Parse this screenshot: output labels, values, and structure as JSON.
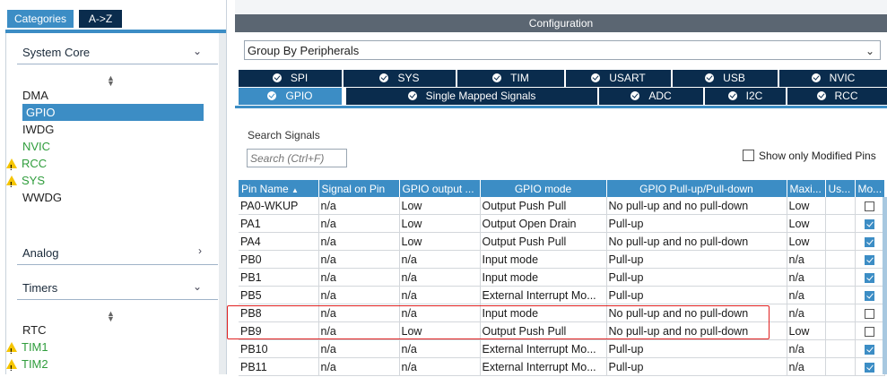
{
  "left_tabs": {
    "categories": "Categories",
    "az": "A->Z"
  },
  "sections": {
    "system_core": "System Core",
    "analog": "Analog",
    "timers": "Timers"
  },
  "system_core_items": [
    {
      "label": "DMA",
      "status": "none"
    },
    {
      "label": "GPIO",
      "status": "selected"
    },
    {
      "label": "IWDG",
      "status": "none"
    },
    {
      "label": "NVIC",
      "status": "ok"
    },
    {
      "label": "RCC",
      "status": "warning"
    },
    {
      "label": "SYS",
      "status": "warning"
    },
    {
      "label": "WWDG",
      "status": "none"
    }
  ],
  "timer_items": [
    {
      "label": "RTC",
      "status": "none"
    },
    {
      "label": "TIM1",
      "status": "warning"
    },
    {
      "label": "TIM2",
      "status": "warning"
    }
  ],
  "configuration": {
    "title": "Configuration",
    "group_by": "Group By Peripherals",
    "tabs_row1": [
      "SPI",
      "SYS",
      "TIM",
      "USART",
      "USB",
      "NVIC"
    ],
    "tabs_row2": [
      "GPIO",
      "Single Mapped Signals",
      "ADC",
      "I2C",
      "RCC"
    ],
    "active_tab": "GPIO"
  },
  "search": {
    "label": "Search Signals",
    "placeholder": "Search (Ctrl+F)"
  },
  "show_modified": "Show only Modified Pins",
  "table": {
    "headers": [
      "Pin Name",
      "Signal on Pin",
      "GPIO output ...",
      "GPIO mode",
      "GPIO Pull-up/Pull-down",
      "Maxi...",
      "Us...",
      "Mo..."
    ],
    "rows": [
      [
        "PA0-WKUP",
        "n/a",
        "Low",
        "Output Push Pull",
        "No pull-up and no pull-down",
        "Low",
        "",
        false
      ],
      [
        "PA1",
        "n/a",
        "Low",
        "Output Open Drain",
        "Pull-up",
        "Low",
        "",
        true
      ],
      [
        "PA4",
        "n/a",
        "Low",
        "Output Push Pull",
        "No pull-up and no pull-down",
        "Low",
        "",
        true
      ],
      [
        "PB0",
        "n/a",
        "n/a",
        "Input mode",
        "Pull-up",
        "n/a",
        "",
        true
      ],
      [
        "PB1",
        "n/a",
        "n/a",
        "Input mode",
        "Pull-up",
        "n/a",
        "",
        true
      ],
      [
        "PB5",
        "n/a",
        "n/a",
        "External Interrupt Mo...",
        "Pull-up",
        "n/a",
        "",
        true
      ],
      [
        "PB8",
        "n/a",
        "n/a",
        "Input mode",
        "No pull-up and no pull-down",
        "n/a",
        "",
        false
      ],
      [
        "PB9",
        "n/a",
        "Low",
        "Output Push Pull",
        "No pull-up and no pull-down",
        "Low",
        "",
        false
      ],
      [
        "PB10",
        "n/a",
        "n/a",
        "External Interrupt Mo...",
        "Pull-up",
        "n/a",
        "",
        true
      ],
      [
        "PB11",
        "n/a",
        "n/a",
        "External Interrupt Mo...",
        "Pull-up",
        "n/a",
        "",
        true
      ]
    ]
  },
  "colors": {
    "accent": "#3c8dc5",
    "dark_tab": "#0a2c4d",
    "header_bar": "#5b6672",
    "ok": "#2f9d3c",
    "warning": "#f5c400",
    "highlight": "#e02020"
  }
}
